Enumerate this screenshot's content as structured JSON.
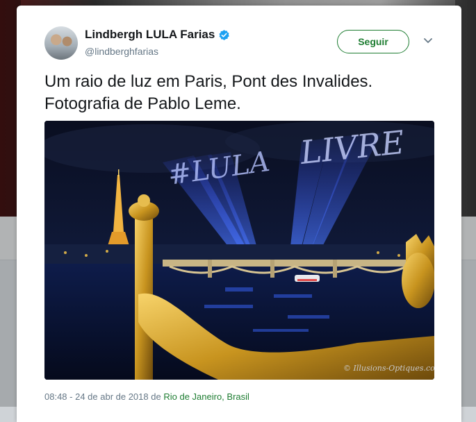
{
  "tweet": {
    "author_name": "Lindbergh LULA Farias",
    "author_handle": "@lindberghfarias",
    "verified": true,
    "follow_label": "Seguir",
    "text": "Um raio de luz em Paris, Pont des Invalides.\nFotografia de Pablo Leme.",
    "timestamp": "08:48 - 24 de abr de 2018",
    "location_prefix": "de",
    "location": "Rio de Janeiro, Brasil"
  },
  "photo": {
    "beam_left_text": "#LULA",
    "beam_right_text": "LIVRE",
    "watermark": "© Illusions-Optiques.com"
  },
  "colors": {
    "follow_accent": "#1e7d32",
    "verified_blue": "#1da1f2",
    "text_primary": "#14171a",
    "text_secondary": "#657786"
  },
  "icons": {
    "verified": "verified-badge-icon",
    "more": "chevron-down-icon"
  }
}
